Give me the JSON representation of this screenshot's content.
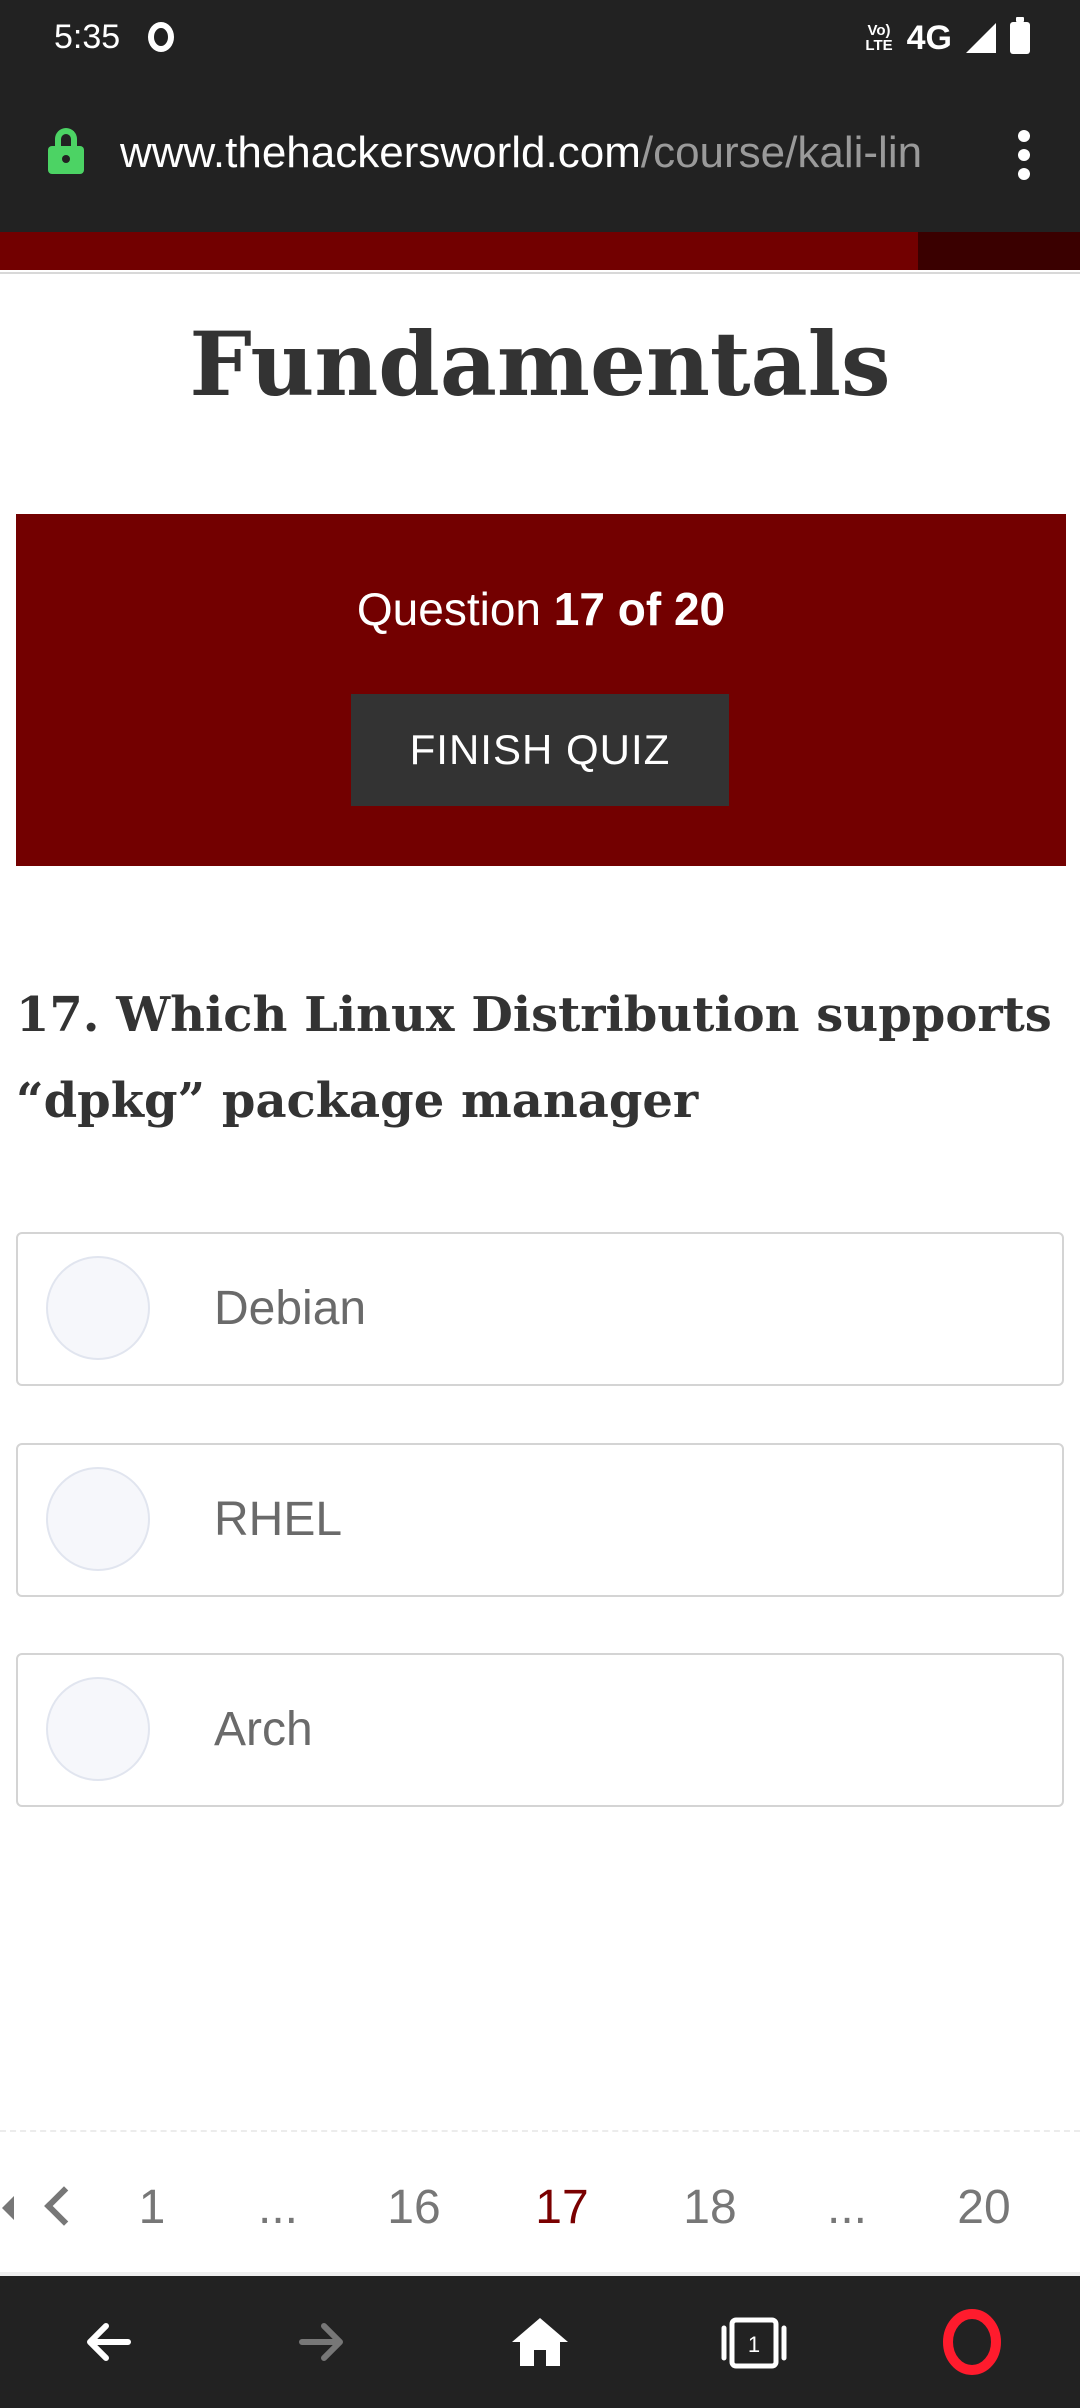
{
  "status_bar": {
    "time": "5:35",
    "volte_top": "Vo)",
    "volte_bottom": "LTE",
    "network": "4G"
  },
  "address_bar": {
    "url_host": "www.thehackersworld.com",
    "url_path": "/course/kali-lin"
  },
  "colors": {
    "accent": "#730000",
    "dark": "#333333",
    "chrome": "#222222",
    "lock": "#4cd364"
  },
  "progress": {
    "fraction": 0.85
  },
  "page": {
    "title": "Fundamentals"
  },
  "quiz": {
    "counter_prefix": "Question ",
    "counter_value": "17 of 20",
    "finish_label": "FINISH QUIZ",
    "question_line1": "17. Which Linux Distribution supports",
    "question_line2": "“dpkg” package manager",
    "answers": [
      "Debian",
      "RHEL",
      "Arch"
    ]
  },
  "pagination": {
    "items": [
      "1",
      "...",
      "16",
      "17",
      "18",
      "...",
      "20"
    ],
    "active": "17"
  },
  "browser_nav": {
    "icons": [
      "back-arrow-icon",
      "forward-arrow-icon",
      "home-icon",
      "tabs-icon",
      "opera-icon"
    ],
    "tab_count": "1"
  }
}
